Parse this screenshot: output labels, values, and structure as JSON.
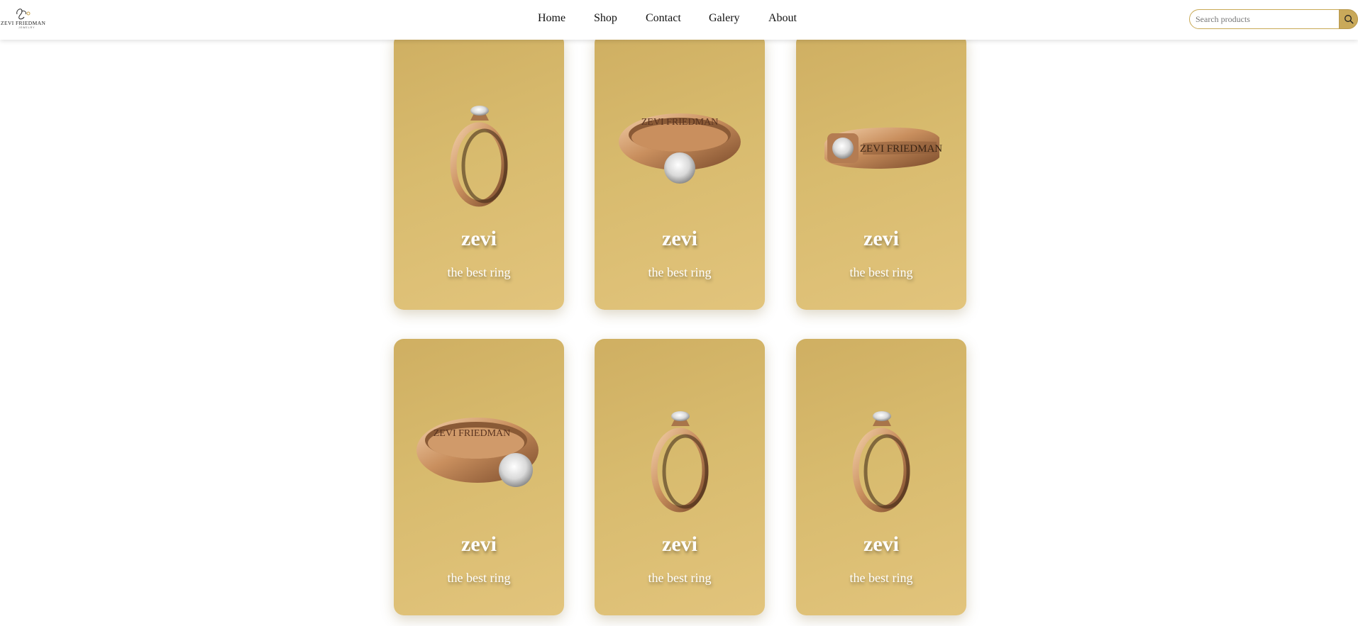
{
  "brand": {
    "logo_text": "ZEVI FRIEDMAN",
    "logo_sub": "JEWELRY"
  },
  "nav": {
    "items": [
      {
        "label": "Home"
      },
      {
        "label": "Shop"
      },
      {
        "label": "Contact"
      },
      {
        "label": "Galery"
      },
      {
        "label": "About"
      }
    ]
  },
  "search": {
    "placeholder": "Search products",
    "value": "",
    "icon": "search-icon"
  },
  "products": [
    {
      "title": "zevi",
      "subtitle": "the best ring",
      "image": "ring-side-view"
    },
    {
      "title": "zevi",
      "subtitle": "the best ring",
      "image": "ring-engraved-front"
    },
    {
      "title": "zevi",
      "subtitle": "the best ring",
      "image": "ring-band-side"
    },
    {
      "title": "zevi",
      "subtitle": "the best ring",
      "image": "ring-engraved-angled"
    },
    {
      "title": "zevi",
      "subtitle": "the best ring",
      "image": "ring-side-view"
    },
    {
      "title": "zevi",
      "subtitle": "the best ring",
      "image": "ring-side-view"
    }
  ],
  "colors": {
    "card_gold": "#d8bb6e",
    "search_border": "#c8a955",
    "search_button": "#c9a95a",
    "ring_rose_gold": "#c98f5e"
  }
}
